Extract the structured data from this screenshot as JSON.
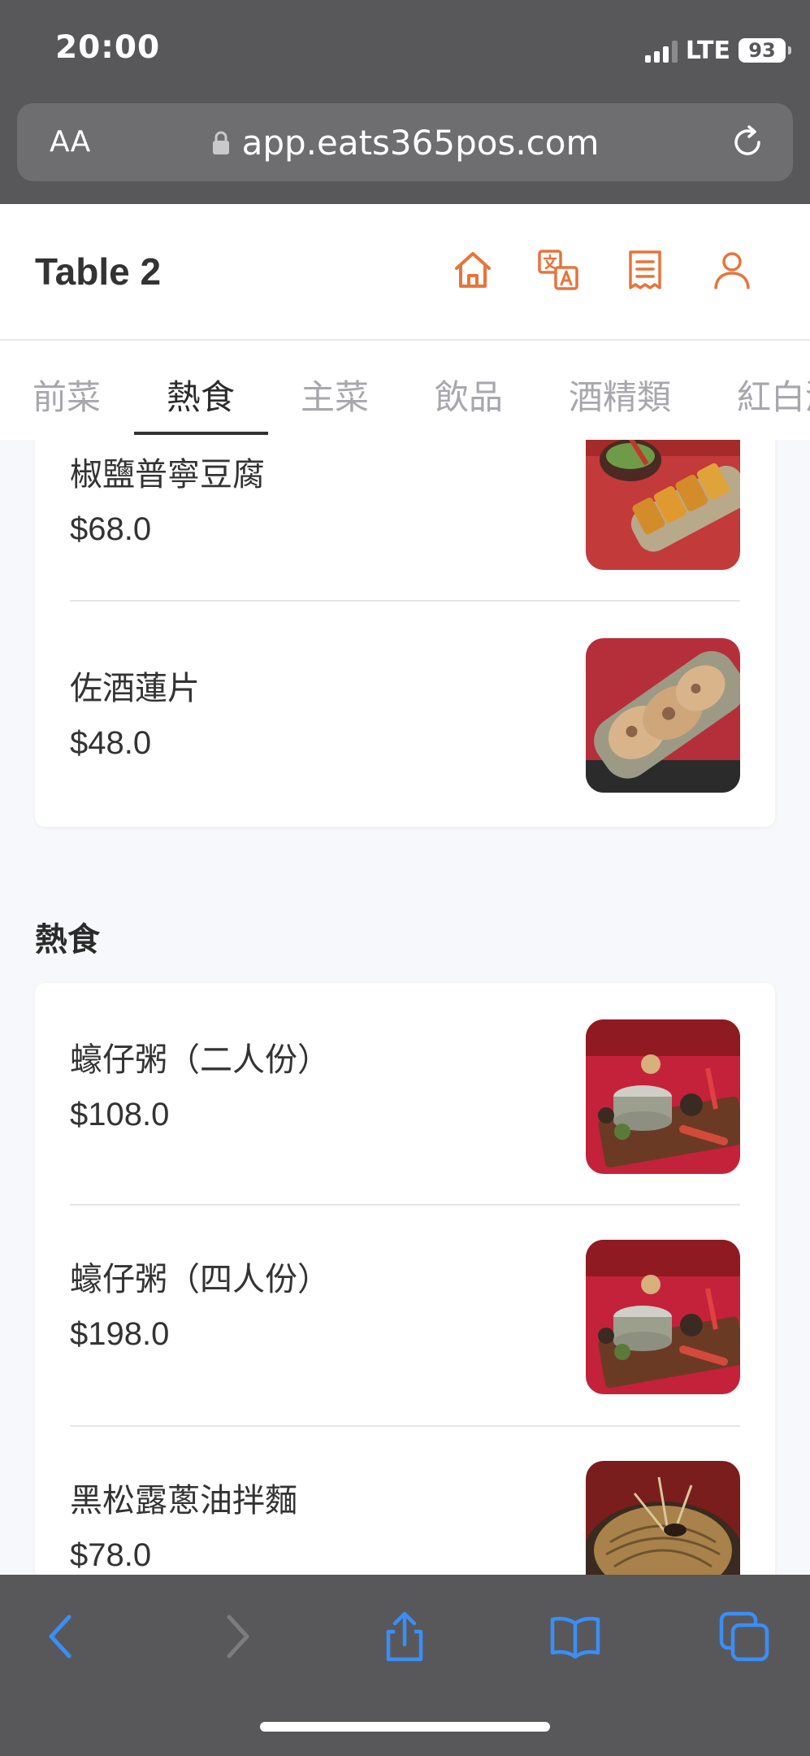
{
  "status_bar": {
    "time": "20:00",
    "network": "LTE",
    "battery": "93"
  },
  "browser": {
    "text_size_label": "AA",
    "url": "app.eats365pos.com"
  },
  "header": {
    "title": "Table 2",
    "icons": [
      "home-icon",
      "translate-icon",
      "receipt-icon",
      "user-icon"
    ],
    "accent_color": "#e8743b"
  },
  "tabs": [
    {
      "label": "前菜",
      "active": false
    },
    {
      "label": "熱食",
      "active": true
    },
    {
      "label": "主菜",
      "active": false
    },
    {
      "label": "飲品",
      "active": false
    },
    {
      "label": "酒精類",
      "active": false
    },
    {
      "label": "紅白酒",
      "active": false
    }
  ],
  "sections": [
    {
      "title": "",
      "items": [
        {
          "name": "椒鹽普寧豆腐",
          "price": "$68.0"
        },
        {
          "name": "佐酒蓮片",
          "price": "$48.0"
        }
      ]
    },
    {
      "title": "熱食",
      "items": [
        {
          "name": "蠔仔粥（二人份）",
          "price": "$108.0"
        },
        {
          "name": "蠔仔粥（四人份）",
          "price": "$198.0"
        },
        {
          "name": "黑松露蔥油拌麵",
          "price": "$78.0"
        }
      ]
    }
  ],
  "toolbar": {
    "icons": [
      "back-icon",
      "forward-icon",
      "share-icon",
      "bookmarks-icon",
      "tabs-icon"
    ],
    "icon_color": "#3a8ef6"
  }
}
